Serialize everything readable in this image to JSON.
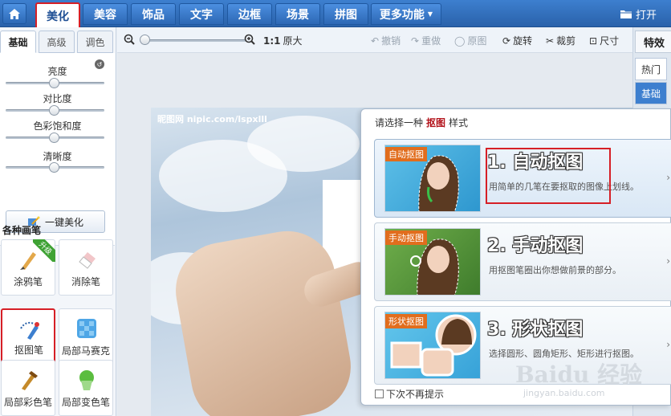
{
  "top_tabs": [
    {
      "label": "美化",
      "active": true
    },
    {
      "label": "美容"
    },
    {
      "label": "饰品"
    },
    {
      "label": "文字"
    },
    {
      "label": "边框"
    },
    {
      "label": "场景"
    },
    {
      "label": "拼图"
    },
    {
      "label": "更多功能",
      "dropdown": true
    }
  ],
  "open_label": "打开",
  "left_panel": {
    "tabs": [
      "基础",
      "高级",
      "调色"
    ],
    "sliders": [
      "亮度",
      "对比度",
      "色彩饱和度",
      "清晰度"
    ],
    "beautify_button": "一键美化",
    "brush_section_title": "各种画笔",
    "upgrade_badge": "升级",
    "tools": [
      "涂鸦笔",
      "消除笔",
      "抠图笔",
      "局部马赛克",
      "局部彩色笔",
      "局部变色笔"
    ]
  },
  "toolbar": {
    "zoom_ratio": "1:1",
    "original_size": "原大",
    "undo": "撤销",
    "redo": "重做",
    "original": "原图",
    "rotate": "旋转",
    "crop": "裁剪",
    "size": "尺寸"
  },
  "right_panel": {
    "title": "特效",
    "tabs": [
      "热门",
      "基础"
    ]
  },
  "canvas": {
    "watermark": "昵图网 nipic.com/lspxlll"
  },
  "popup": {
    "prompt_prefix": "请选择一种",
    "prompt_em": "抠图",
    "prompt_suffix": "样式",
    "options": [
      {
        "tag": "自动抠图",
        "title": "1. 自动抠图",
        "desc": "用简单的几笔在要抠取的图像上划线。"
      },
      {
        "tag": "手动抠图",
        "title": "2. 手动抠图",
        "desc": "用抠图笔圈出你想做前景的部分。"
      },
      {
        "tag": "形状抠图",
        "title": "3. 形状抠图",
        "desc": "选择圆形、圆角矩形、矩形进行抠图。"
      }
    ],
    "dont_show": "下次不再提示"
  },
  "watermark_site": {
    "brand": "Baidu 经验",
    "url": "jingyan.baidu.com"
  }
}
